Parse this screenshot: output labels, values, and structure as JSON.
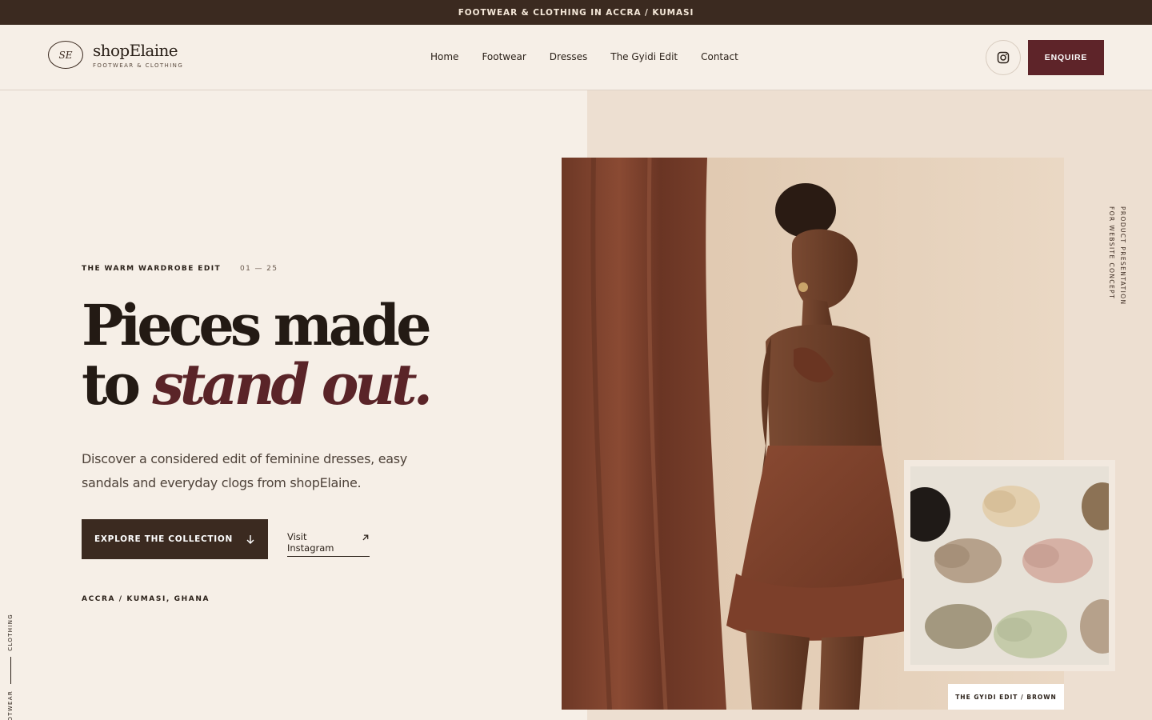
{
  "topbar": {
    "text": "FOOTWEAR & CLOTHING IN ACCRA / KUMASI"
  },
  "brand": {
    "monogram": "SE",
    "name": "shopElaine",
    "tagline": "FOOTWEAR & CLOTHING"
  },
  "nav": {
    "items": [
      "Home",
      "Footwear",
      "Dresses",
      "The Gyidi Edit",
      "Contact"
    ]
  },
  "header": {
    "enquire_label": "ENQUIRE",
    "instagram_icon": "instagram-icon"
  },
  "hero": {
    "kicker": "THE WARM WARDROBE EDIT",
    "kicker_count": "01 — 25",
    "headline_line1": "Pieces made",
    "headline_line2_plain": "to ",
    "headline_line2_accent": "stand out.",
    "description": "Discover a considered edit of feminine dresses, easy sandals and everyday clogs from shopElaine.",
    "cta_label": "EXPLORE THE COLLECTION",
    "secondary_label": "Visit Instagram",
    "location": "ACCRA / KUMASI, GHANA"
  },
  "side_label": {
    "top": "CLOTHING",
    "bottom": "FOOTWEAR"
  },
  "vertical_note": {
    "line1": "PRODUCT PRESENTATION",
    "line2": "FOR WEBSITE CONCEPT"
  },
  "caption": "THE GYIDI EDIT / BROWN",
  "colors": {
    "dark": "#3b2a20",
    "accent": "#5e2429",
    "background": "#f6efe7",
    "panel": "#eddfd1"
  }
}
